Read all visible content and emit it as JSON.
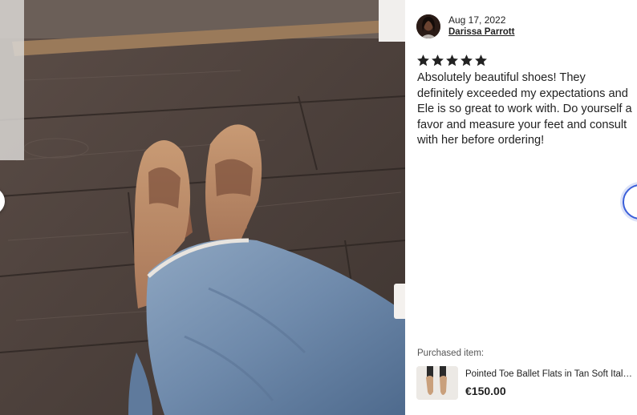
{
  "photo": {
    "description_icon": "review-photo",
    "nav_prev_icon": "chevron-left-icon"
  },
  "review": {
    "date": "Aug 17, 2022",
    "reviewer_name": "Darissa Parrott",
    "rating": 5,
    "rating_max": 5,
    "star_color": "#222222",
    "text": "Absolutely beautiful shoes! They definitely exceeded my expectations and Ele is so great to work with. Do yourself a favor and measure your feet and consult with her before ordering!"
  },
  "purchased": {
    "label": "Purchased item:",
    "item_title": "Pointed Toe Ballet Flats in Tan Soft Italian Leather",
    "price": "€150.00"
  },
  "nav": {
    "next_icon": "chevron-right-icon",
    "accent_color": "#3b5fd9"
  }
}
